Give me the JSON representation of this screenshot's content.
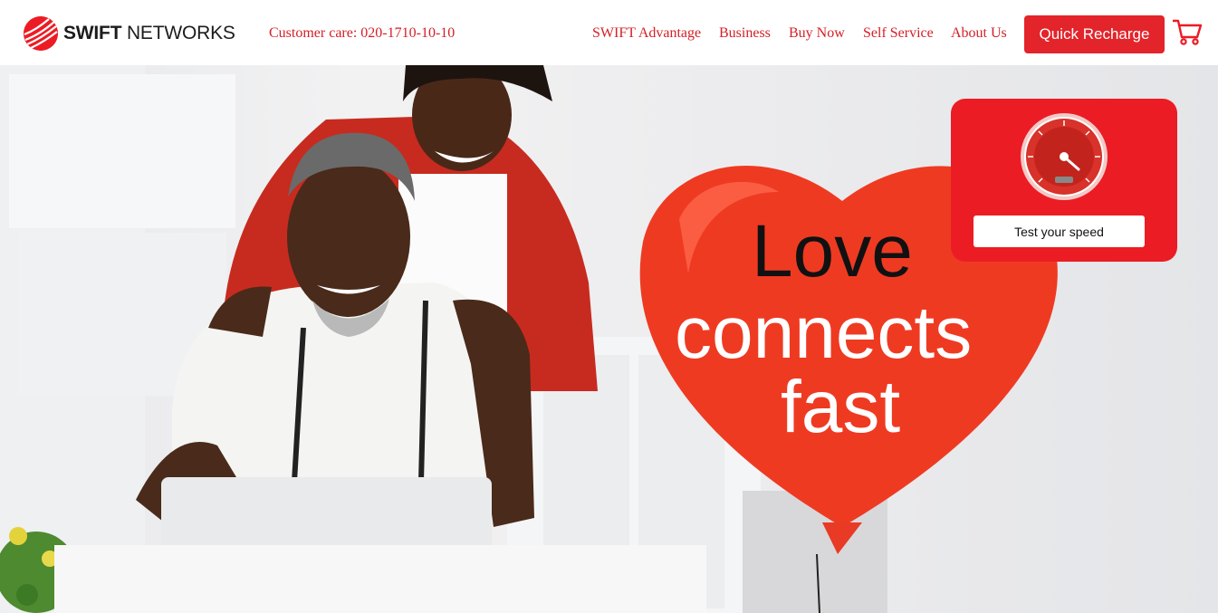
{
  "brand": {
    "name_bold": "SWIFT",
    "name_light": " NETWORKS",
    "accent": "#ec1c24"
  },
  "header": {
    "customer_care": "Customer care: 020-1710-10-10",
    "nav": [
      "SWIFT Advantage",
      "Business",
      "Buy Now",
      "Self Service",
      "About Us"
    ],
    "quick_recharge": "Quick Recharge",
    "cart_icon": "shopping-cart-icon"
  },
  "hero": {
    "line1": "Love",
    "line2": "connects",
    "line3": "fast"
  },
  "speed_widget": {
    "gauge_icon": "speedometer-icon",
    "button": "Test your speed"
  }
}
